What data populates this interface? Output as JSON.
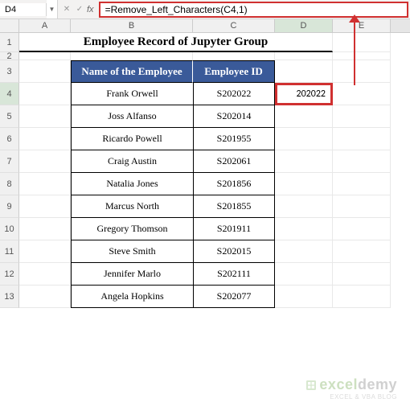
{
  "nameBox": "D4",
  "formula": "=Remove_Left_Characters(C4,1)",
  "columns": [
    "A",
    "B",
    "C",
    "D",
    "E"
  ],
  "title": "Employee Record of Jupyter Group",
  "headers": {
    "name": "Name of the Employee",
    "id": "Employee ID"
  },
  "d4_value": "202022",
  "chart_data": {
    "type": "table",
    "columns": [
      "Name of the Employee",
      "Employee ID"
    ],
    "rows": [
      [
        "Frank Orwell",
        "S202022"
      ],
      [
        "Joss Alfanso",
        "S202014"
      ],
      [
        "Ricardo Powell",
        "S201955"
      ],
      [
        "Craig Austin",
        "S202061"
      ],
      [
        "Natalia Jones",
        "S201856"
      ],
      [
        "Marcus North",
        "S201855"
      ],
      [
        "Gregory Thomson",
        "S201911"
      ],
      [
        "Steve Smith",
        "S202015"
      ],
      [
        "Jennifer Marlo",
        "S202111"
      ],
      [
        "Angela Hopkins",
        "S202077"
      ]
    ]
  },
  "rowNums": [
    "1",
    "2",
    "3",
    "4",
    "5",
    "6",
    "7",
    "8",
    "9",
    "10",
    "11",
    "12",
    "13"
  ],
  "watermark": {
    "brand_a": "excel",
    "brand_b": "demy",
    "tag": "EXCEL & VBA BLOG"
  }
}
